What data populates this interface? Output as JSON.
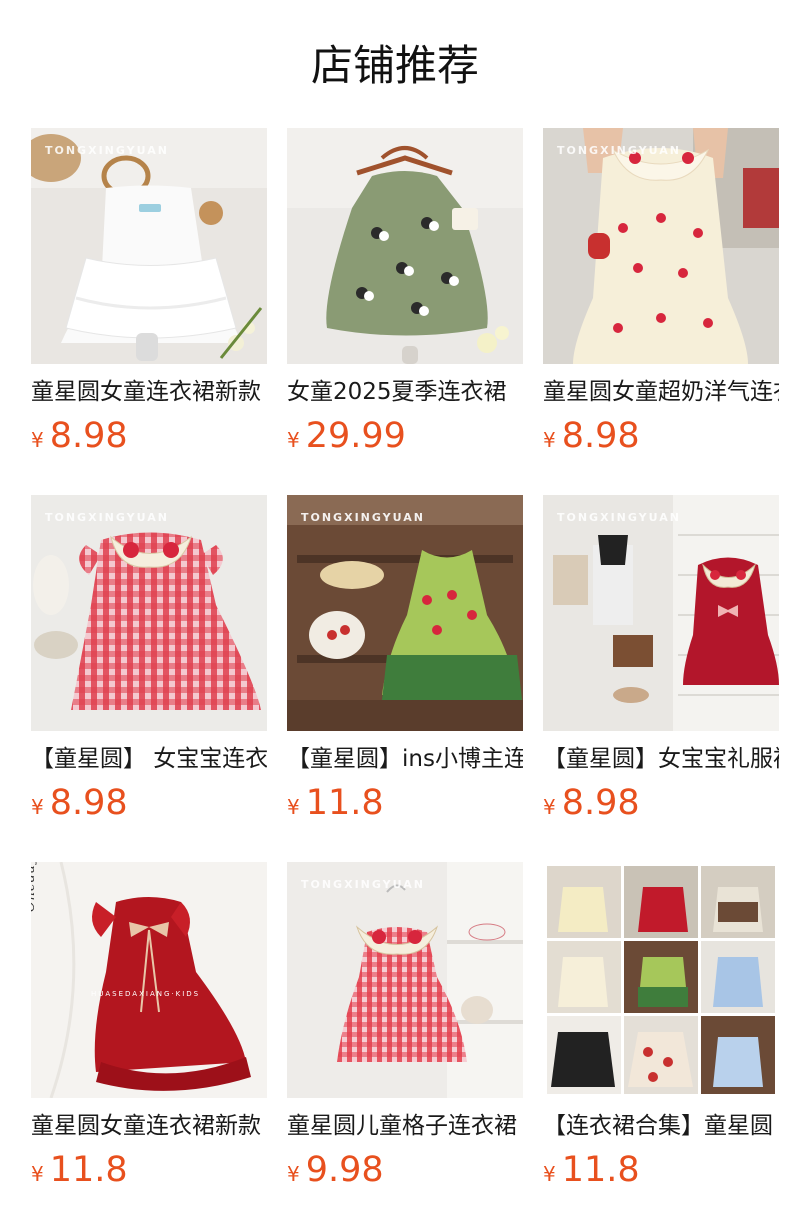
{
  "section": {
    "title": "店铺推荐"
  },
  "watermark": "TONGXINGYUAN",
  "products": [
    {
      "name": "童星圆女童连衣裙新款",
      "currency": "¥",
      "price": "8.98",
      "image": "white-tiered-tutu-dress"
    },
    {
      "name": "女童2025夏季连衣裙",
      "currency": "¥",
      "price": "29.99",
      "image": "green-panda-print-dress"
    },
    {
      "name": "童星圆女童超奶洋气连衣裙",
      "currency": "¥",
      "price": "8.98",
      "image": "cream-cherry-ruffle-dress"
    },
    {
      "name": "【童星圆】 女宝宝连衣裙",
      "currency": "¥",
      "price": "8.98",
      "image": "red-gingham-strawberry-collar-dress"
    },
    {
      "name": "【童星圆】ins小博主连衣裙",
      "currency": "¥",
      "price": "11.8",
      "image": "green-watermelon-dress"
    },
    {
      "name": "【童星圆】女宝宝礼服裙",
      "currency": "¥",
      "price": "8.98",
      "image": "red-party-dress-with-bows"
    },
    {
      "name": "童星圆女童连衣裙新款",
      "currency": "¥",
      "price": "11.8",
      "image": "red-bow-ruffle-dress"
    },
    {
      "name": "童星圆儿童格子连衣裙",
      "currency": "¥",
      "price": "9.98",
      "image": "red-gingham-dress-on-hanger"
    },
    {
      "name": "【连衣裙合集】童星圆",
      "currency": "¥",
      "price": "11.8",
      "image": "dress-collection-collage"
    }
  ]
}
